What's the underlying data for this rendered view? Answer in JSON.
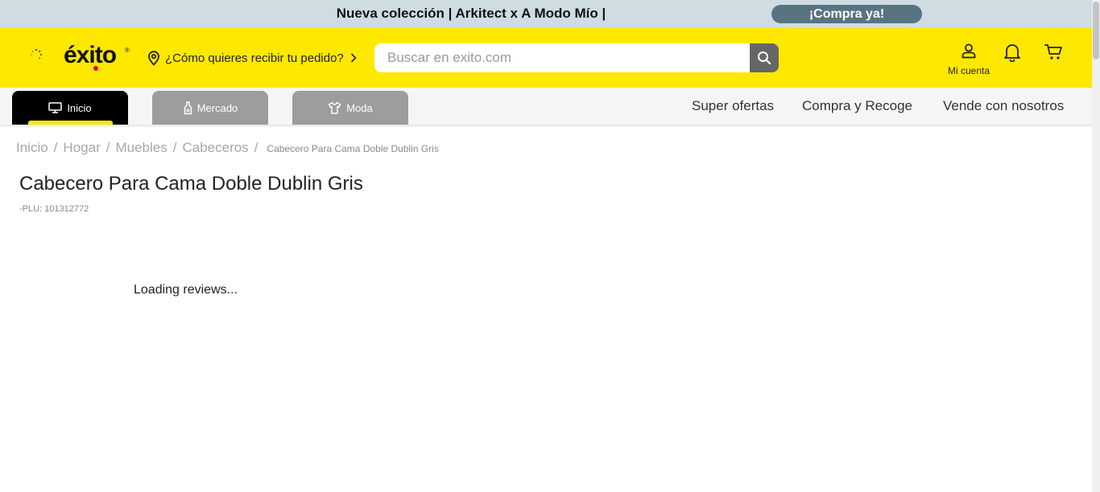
{
  "promo": {
    "text": "Nueva colección | Arkitect x A Modo Mío |",
    "button_label": "¡Compra ya!"
  },
  "header": {
    "logo_text": "éxito",
    "logo_reg": "®",
    "location_text": "¿Cómo quieres recibir tu pedido?",
    "search": {
      "placeholder": "Buscar en exito.com",
      "value": ""
    },
    "account_label": "Mi cuenta",
    "icons": [
      "spinner-icon",
      "location-pin-icon",
      "chevron-right-icon",
      "search-icon",
      "user-icon",
      "bell-icon",
      "cart-icon"
    ]
  },
  "nav": {
    "tabs": [
      {
        "label": "Inicio",
        "icon": "monitor-icon",
        "active": true
      },
      {
        "label": "Mercado",
        "icon": "bottle-icon",
        "active": false
      },
      {
        "label": "Moda",
        "icon": "shirt-icon",
        "active": false
      }
    ],
    "links": [
      "Super ofertas",
      "Compra y Recoge",
      "Vende con nosotros"
    ]
  },
  "breadcrumb": {
    "items": [
      "Inicio",
      "Hogar",
      "Muebles",
      "Cabeceros"
    ],
    "separator": "/",
    "current": "Cabecero Para Cama Doble Dublin Gris"
  },
  "product": {
    "title": "Cabecero Para Cama Doble Dublin Gris",
    "plu": "-PLU: 101312772"
  },
  "reviews": {
    "status": "Loading reviews..."
  },
  "colors": {
    "brand_yellow": "#ffe800",
    "promo_bg": "#cfdde3",
    "promo_button": "#587481",
    "tab_active": "#000000",
    "tab_inactive": "#9d9d9d",
    "logo_dot": "#e4002b"
  }
}
